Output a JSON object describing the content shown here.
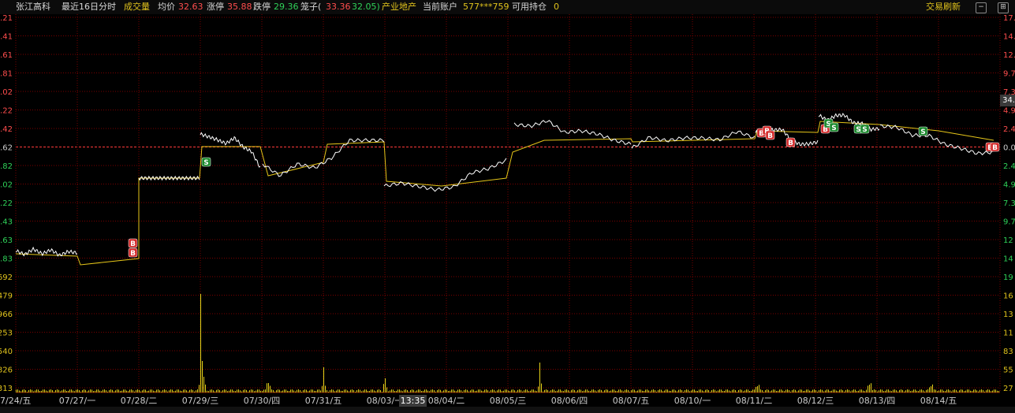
{
  "header": {
    "stock_name": "张江高科",
    "period": "最近16日分时",
    "volume_label": "成交量",
    "avg_label": "均价",
    "avg_value": "32.63",
    "limit_up_label": "涨停",
    "limit_up_value": "35.88",
    "limit_down_label": "跌停",
    "limit_down_value": "29.36",
    "cage_label": "笼子(",
    "cage_high": "33.36",
    "cage_low": "32.05)",
    "industry": "产业地产",
    "account_label": "当前账户",
    "account_value": "577***759",
    "holding_label": "可用持仓",
    "holding_value": "0",
    "refresh": "交易刷新"
  },
  "left_axis": {
    "price_ticks": [
      ".21",
      ".41",
      ".61",
      ".81",
      ".02",
      ".22",
      ".42",
      ".62",
      ".82",
      ".02",
      ".22",
      ".43",
      ".63",
      ".83"
    ],
    "volume_ticks": [
      "692",
      "479",
      "966",
      "253",
      "540",
      "826",
      "313"
    ]
  },
  "right_axis": {
    "pct_ticks": [
      "17.",
      "14.",
      "12.",
      "9.7",
      "7.3",
      "4.9",
      "2.4",
      "0.0",
      "2.4",
      "4.9",
      "7.3",
      "9.7",
      "12",
      "14",
      "19"
    ],
    "volume_ticks": [
      "16",
      "13",
      "11",
      "83",
      "55",
      "27"
    ],
    "cursor_value": "34."
  },
  "time_axis": {
    "dates": [
      "7/24/五",
      "07/27/一",
      "07/28/二",
      "07/29/三",
      "07/30/四",
      "07/31/五",
      "08/03/一",
      "08/04/二",
      "08/05/三",
      "08/06/四",
      "08/07/五",
      "08/10/一",
      "08/11/二",
      "08/12/三",
      "08/13/四",
      "08/14/五"
    ],
    "cursor_time": "13:35"
  },
  "markers": {
    "buy": "B",
    "sell": "S"
  },
  "colors": {
    "grid": "#7a0000",
    "price_line": "#ffffff",
    "avg_line": "#e6c619",
    "volume": "#e6d319",
    "ref_line": "#ff3a3a",
    "buy_marker": "#d42b2b",
    "sell_marker": "#1b8a2e"
  }
}
